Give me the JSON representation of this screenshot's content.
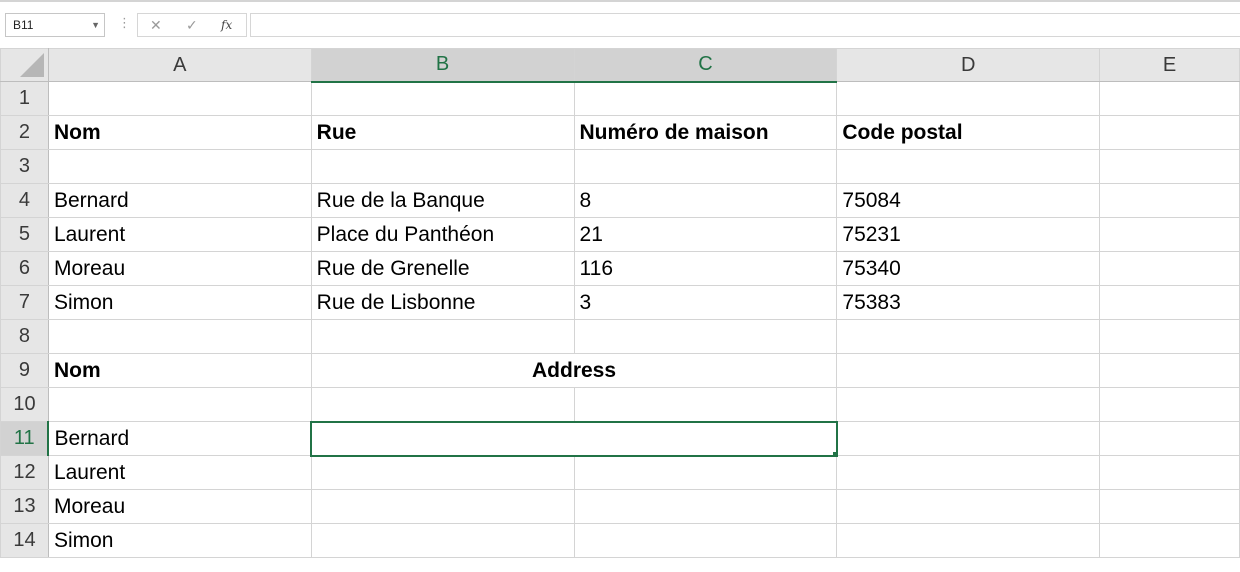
{
  "formula_bar": {
    "name_box": "B11",
    "name_box_dropdown_icon": "chevron-down-icon",
    "cancel_icon": "close-icon",
    "enter_icon": "check-icon",
    "fx_label": "fx",
    "formula_value": ""
  },
  "columns": [
    "A",
    "B",
    "C",
    "D",
    "E"
  ],
  "selected_columns": [
    "B",
    "C"
  ],
  "selected_row": 11,
  "accent_color": "#217346",
  "rows": [
    {
      "num": "1",
      "a": "",
      "b": "",
      "c": "",
      "d": "",
      "e": ""
    },
    {
      "num": "2",
      "a": "Nom",
      "b": "Rue",
      "c": "Numéro de maison",
      "d": "Code postal",
      "e": ""
    },
    {
      "num": "3",
      "a": "",
      "b": "",
      "c": "",
      "d": "",
      "e": ""
    },
    {
      "num": "4",
      "a": "Bernard",
      "b": "Rue de la Banque",
      "c": "8",
      "d": "75084",
      "e": ""
    },
    {
      "num": "5",
      "a": "Laurent",
      "b": "Place du Panthéon",
      "c": "21",
      "d": "75231",
      "e": ""
    },
    {
      "num": "6",
      "a": "Moreau",
      "b": "Rue de Grenelle",
      "c": "116",
      "d": "75340",
      "e": ""
    },
    {
      "num": "7",
      "a": "Simon",
      "b": "Rue de Lisbonne",
      "c": "3",
      "d": "75383",
      "e": ""
    },
    {
      "num": "8",
      "a": "",
      "b": "",
      "c": "",
      "d": "",
      "e": ""
    },
    {
      "num": "9",
      "a": "Nom",
      "bc_merged": "Address",
      "d": "",
      "e": ""
    },
    {
      "num": "10",
      "a": "",
      "b": "",
      "c": "",
      "d": "",
      "e": ""
    },
    {
      "num": "11",
      "a": "Bernard",
      "bc_merged": "",
      "d": "",
      "e": ""
    },
    {
      "num": "12",
      "a": "Laurent",
      "b": "",
      "c": "",
      "d": "",
      "e": ""
    },
    {
      "num": "13",
      "a": "Moreau",
      "b": "",
      "c": "",
      "d": "",
      "e": ""
    },
    {
      "num": "14",
      "a": "Simon",
      "b": "",
      "c": "",
      "d": "",
      "e": ""
    }
  ]
}
